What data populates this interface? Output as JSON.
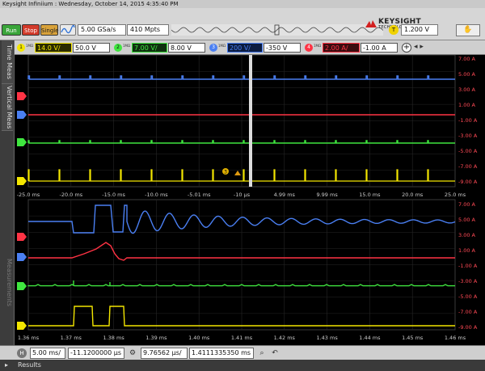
{
  "window": {
    "title": "Keysight Infiniium : Wednesday, October 14, 2015 4:35:40 PM"
  },
  "toolbar": {
    "run_label": "Run",
    "stop_label": "Stop",
    "single_label": "Single",
    "sample_rate": "5.00 GSa/s",
    "memory_depth": "410 Mpts",
    "trigger_source_badge": "T",
    "trigger_level": "1.200 V",
    "brand_name": "KEYSIGHT",
    "brand_tagline": "TECHNOLOGIES",
    "touch_icon": "touch-hand-icon",
    "auto_icon": "autoscale-icon"
  },
  "channels": [
    {
      "id": "1",
      "impedance": "1MΩ",
      "scale": "14.0 V/",
      "offset": "50.0 V",
      "color": "#f3e600"
    },
    {
      "id": "2",
      "impedance": "1MΩ",
      "scale": "7.00 V/",
      "offset": "8.00 V",
      "color": "#3fe63f"
    },
    {
      "id": "3",
      "impedance": "1MΩ",
      "scale": "200 V/",
      "offset": "-350 V",
      "color": "#4a7ff2"
    },
    {
      "id": "4",
      "impedance": "1MΩ",
      "scale": "2.00 A/",
      "offset": "-1.00 A",
      "color": "#ff3344"
    }
  ],
  "side_tabs": [
    "Time Meas",
    "Vertical Meas",
    "Measurements"
  ],
  "main_grid": {
    "right_axis": [
      "7.00 A",
      "5.00 A",
      "3.00 A",
      "1.00 A",
      "-1.00 A",
      "-3.00 A",
      "-5.00 A",
      "-7.00 A",
      "-9.00 A"
    ],
    "time_axis": [
      "-25.0 ms",
      "-20.0 ms",
      "-15.0 ms",
      "-10.0 ms",
      "-5.01 ms",
      "-10 µs",
      "4.99 ms",
      "9.99 ms",
      "15.0 ms",
      "20.0 ms",
      "25.0 ms"
    ]
  },
  "zoom_grid": {
    "right_axis": [
      "7.00 A",
      "5.00 A",
      "3.00 A",
      "1.00 A",
      "-1.00 A",
      "-3.00 A",
      "-5.00 A",
      "-7.00 A",
      "-9.00 A"
    ],
    "time_axis": [
      "1.36 ms",
      "1.37 ms",
      "1.38 ms",
      "1.39 ms",
      "1.40 ms",
      "1.41 ms",
      "1.42 ms",
      "1.43 ms",
      "1.44 ms",
      "1.45 ms",
      "1.46 ms"
    ]
  },
  "trigger_marker_label": "3",
  "horizontal": {
    "badge": "H",
    "main_scale": "5.00 ms/",
    "main_position": "-11.1200000 µs",
    "zoom_scale": "9.76562 µs/",
    "zoom_position": "1.4111335350 ms",
    "icons": [
      "settings-icon",
      "zoom-icon",
      "undo-icon",
      "redo-icon"
    ]
  },
  "results": {
    "label": "Results"
  }
}
